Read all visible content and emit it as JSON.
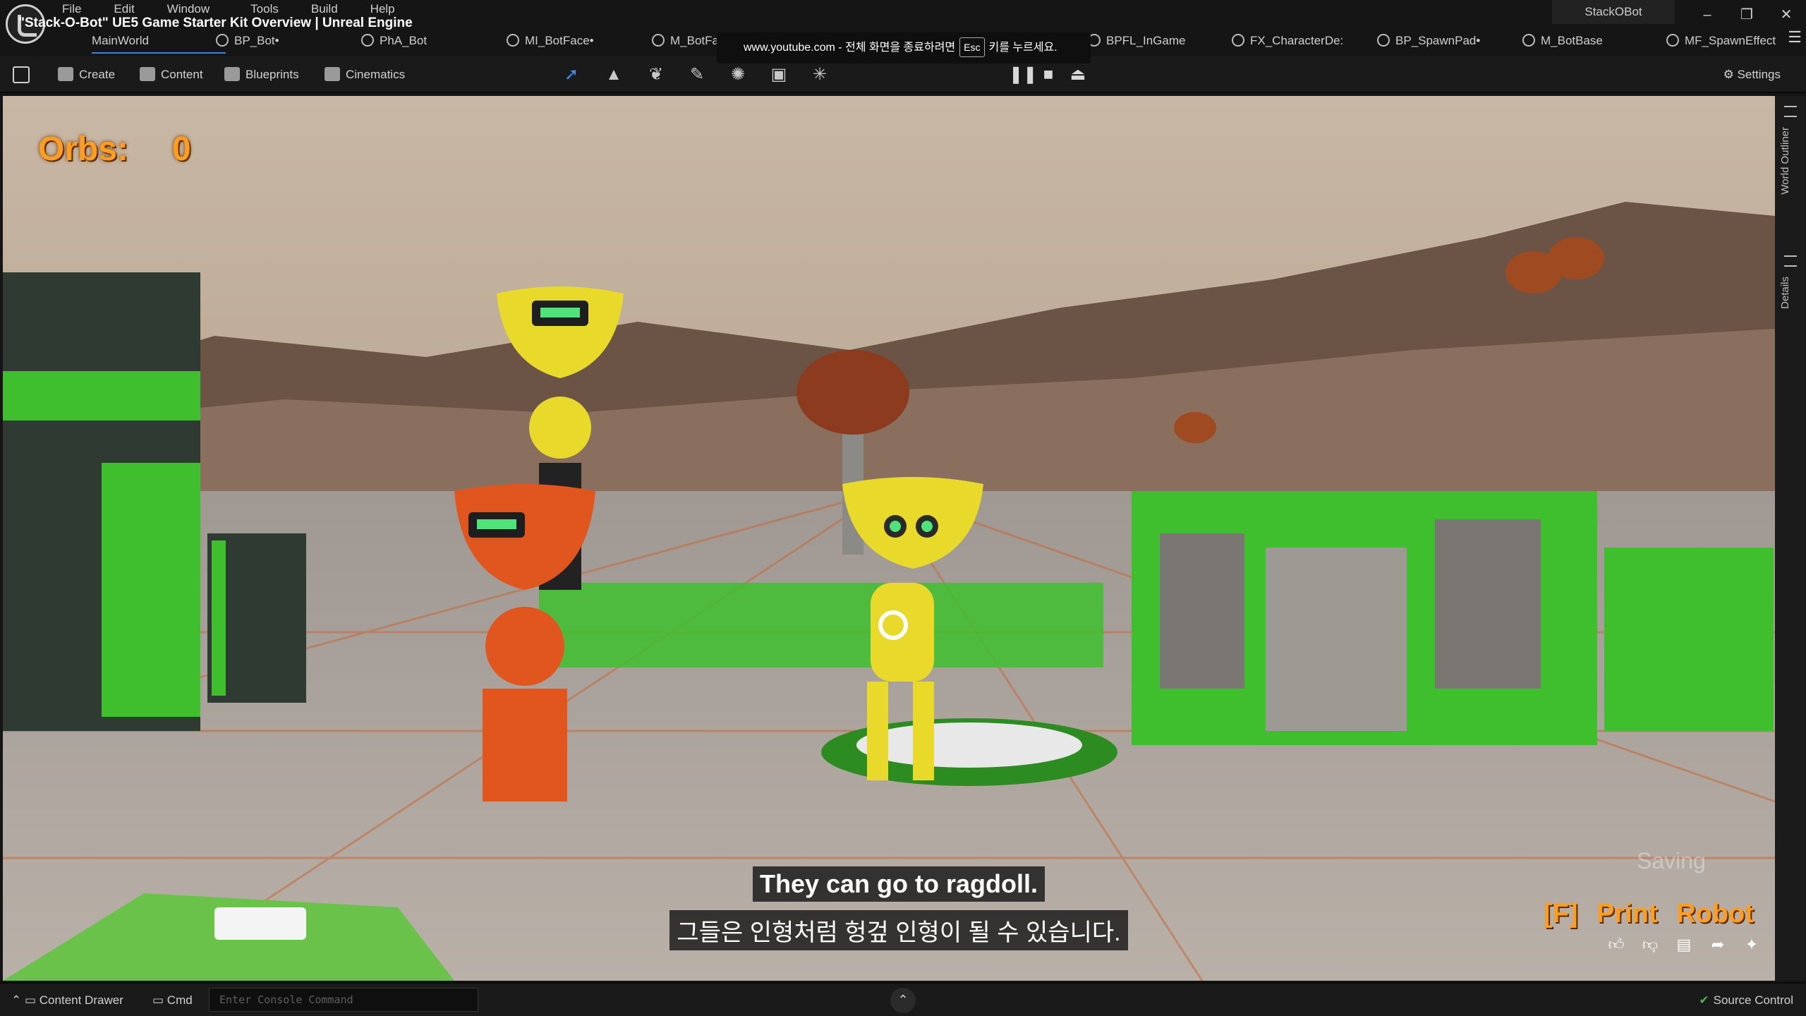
{
  "app": {
    "window_title": "\"Stack-O-Bot\" UE5 Game Starter Kit Overview | Unreal Engine",
    "project_name": "StackOBot"
  },
  "menu": [
    "File",
    "Edit",
    "Window",
    "Tools",
    "Build",
    "Help"
  ],
  "tabs": [
    {
      "label": "MainWorld",
      "icon": "level-icon",
      "active": true
    },
    {
      "label": "BP_Bot•",
      "icon": "blueprint-icon"
    },
    {
      "label": "PhA_Bot",
      "icon": "physics-asset-icon"
    },
    {
      "label": "MI_BotFace•",
      "icon": "material-instance-icon"
    },
    {
      "label": "M_BotFa",
      "icon": "material-icon"
    },
    {
      "label": "BPFL_InGame",
      "icon": "function-library-icon"
    },
    {
      "label": "FX_CharacterDe:",
      "icon": "niagara-icon"
    },
    {
      "label": "BP_SpawnPad•",
      "icon": "blueprint-icon"
    },
    {
      "label": "M_BotBase",
      "icon": "material-icon"
    },
    {
      "label": "MF_SpawnEffect",
      "icon": "material-function-icon"
    }
  ],
  "yt_notice": {
    "domain": "www.youtube.com",
    "text_before": "전체 화면을 종료하려면",
    "key": "Esc",
    "text_after": "키를 누르세요."
  },
  "toolbar": {
    "create": "Create",
    "content": "Content",
    "blueprints": "Blueprints",
    "cinematics": "Cinematics",
    "settings": "Settings",
    "modes": [
      "select-mode-icon",
      "landscape-mode-icon",
      "foliage-mode-icon",
      "mesh-paint-mode-icon",
      "fracture-mode-icon",
      "brush-edit-mode-icon",
      "animation-mode-icon"
    ],
    "play_controls": [
      "pause-icon",
      "stop-icon",
      "eject-icon"
    ]
  },
  "hud": {
    "orbs_label": "Orbs:",
    "orbs_value": "0",
    "action_hint": "[F] Print Robot",
    "saving": "Saving"
  },
  "subtitles": {
    "english": "They can go to ragdoll.",
    "korean": "그들은 인형처럼 헝겊 인형이 될 수 있습니다."
  },
  "side_panel": [
    "World Outliner",
    "Details"
  ],
  "statusbar": {
    "content_drawer": "Content Drawer",
    "cmd": "Cmd",
    "console_placeholder": "Enter Console Command",
    "source_control": "Source Control"
  },
  "colors": {
    "hud_orange": "#ff9d22",
    "robot_yellow": "#e8d92a",
    "robot_orange": "#e0561e",
    "structure_green": "#3fbf2e",
    "accent_blue": "#3f8df0"
  }
}
